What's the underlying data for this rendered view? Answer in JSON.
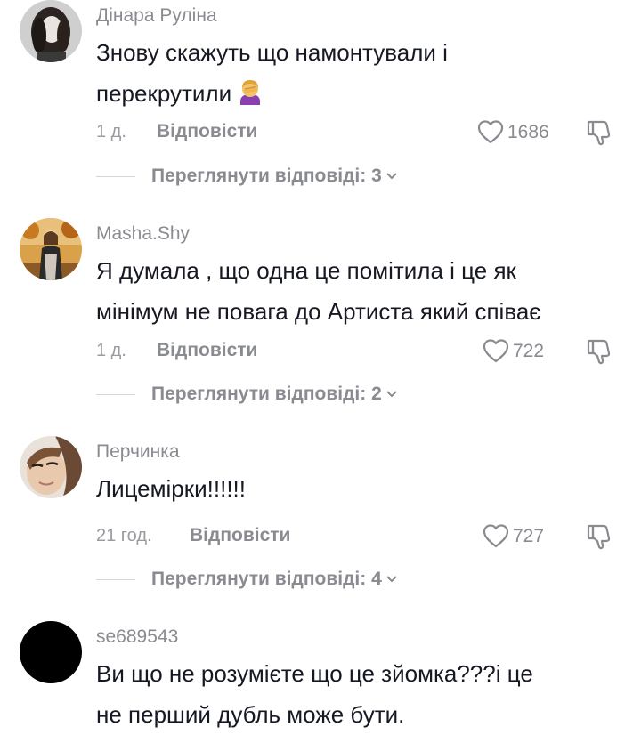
{
  "comments": [
    {
      "username": "Дінара Руліна",
      "text_line1": "Знову скажуть що намонтували і",
      "text_line2": "перекрутили",
      "emoji": "facepalm-woman",
      "time": "1 д.",
      "reply_label": "Відповісти",
      "likes": "1686",
      "view_replies": "Переглянути відповіді: 3"
    },
    {
      "username": "Masha.Shy",
      "text_line1": "Я думала , що одна це помітила і це як",
      "text_line2": "мінімум не повага до Артиста який співає",
      "time": "1 д.",
      "reply_label": "Відповісти",
      "likes": "722",
      "view_replies": "Переглянути відповіді: 2"
    },
    {
      "username": "Перчинка",
      "text_line1": "Лицемірки!!!!!!",
      "time": "21 год.",
      "reply_label": "Відповісти",
      "likes": "727",
      "view_replies": "Переглянути відповіді: 4"
    },
    {
      "username": "se689543",
      "text_line1": "Ви що не розумієте що це зйомка???і це",
      "text_line2": "не перший дубль може бути."
    }
  ],
  "colors": {
    "text": "#161823",
    "secondary": "#8a8b91",
    "divider": "#d6d6d8"
  }
}
